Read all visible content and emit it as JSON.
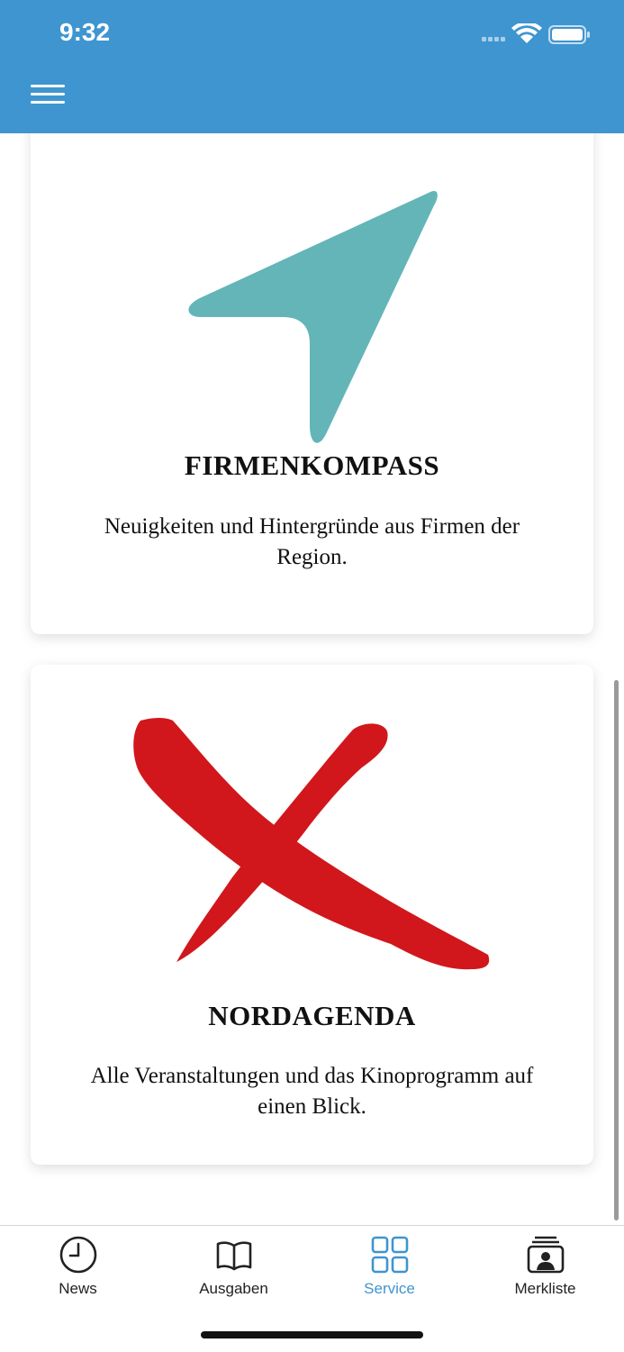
{
  "status_bar": {
    "time": "9:32"
  },
  "header": {
    "menu_icon": "hamburger-menu-icon"
  },
  "cards": [
    {
      "title": "FIRMENKOMPASS",
      "description": "Neuigkeiten und Hintergründe aus Firmen der Region.",
      "icon": "compass-arrow-icon",
      "icon_color": "#63b5b8"
    },
    {
      "title": "NORDAGENDA",
      "description": "Alle Veranstaltungen und das Kinoprogramm auf einen Blick.",
      "icon": "red-cross-icon",
      "icon_color": "#d1171c"
    }
  ],
  "tabbar": {
    "tabs": [
      {
        "label": "News",
        "icon": "clock-icon"
      },
      {
        "label": "Ausgaben",
        "icon": "open-book-icon"
      },
      {
        "label": "Service",
        "icon": "grid-icon",
        "active": true
      },
      {
        "label": "Merkliste",
        "icon": "contact-card-icon"
      }
    ]
  },
  "colors": {
    "header": "#3f95cf",
    "accent": "#3f95cf"
  }
}
